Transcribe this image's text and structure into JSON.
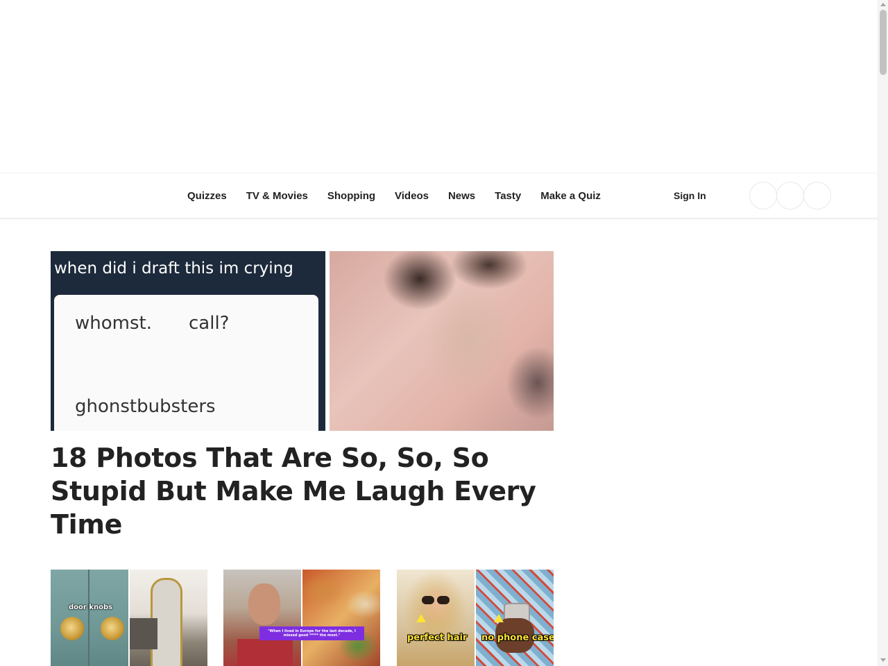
{
  "nav": {
    "links": [
      "Quizzes",
      "TV & Movies",
      "Shopping",
      "Videos",
      "News",
      "Tasty",
      "Make a Quiz"
    ],
    "sign_in": "Sign In"
  },
  "hero": {
    "caption": "when did i draft this im crying",
    "words": [
      "whomst.",
      "call?",
      "ghonstbubsters"
    ]
  },
  "article": {
    "headline": "18 Photos That Are So, So, So Stupid But Make Me Laugh Every Time"
  },
  "thumbnails": [
    {
      "label": "door knobs"
    },
    {
      "label": "\"When I lived in Europe for the last decade, I missed good ***** the most.\""
    },
    {
      "labels": [
        "perfect hair",
        "no phone case"
      ]
    }
  ]
}
